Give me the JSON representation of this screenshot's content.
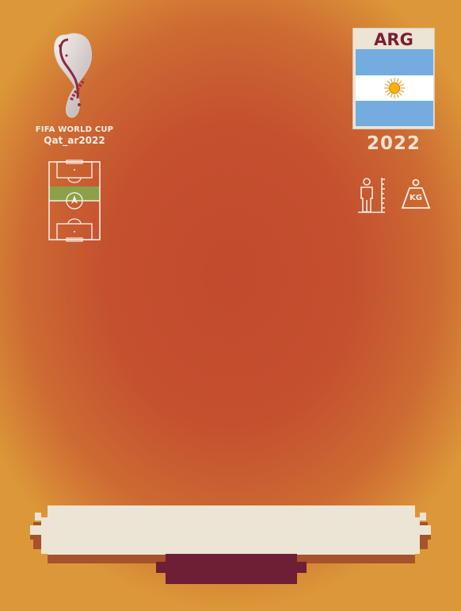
{
  "tournament": {
    "logo_line1": "FIFA WORLD CUP",
    "logo_line2": "Qat_ar2022"
  },
  "team": {
    "code": "ARG",
    "year": "2022"
  },
  "colors": {
    "card_center": "#c24a2e",
    "card_edge": "#dc9838",
    "maroon": "#6e1f36",
    "cream": "#ece4d4",
    "flag_blue": "#74acdf",
    "pitch_highlight": "#8aa14a"
  },
  "icons": {
    "height": "height-ruler-icon",
    "weight": "weight-kg-icon",
    "position": "pitch-position-icon"
  },
  "weight_icon_label": "KG"
}
